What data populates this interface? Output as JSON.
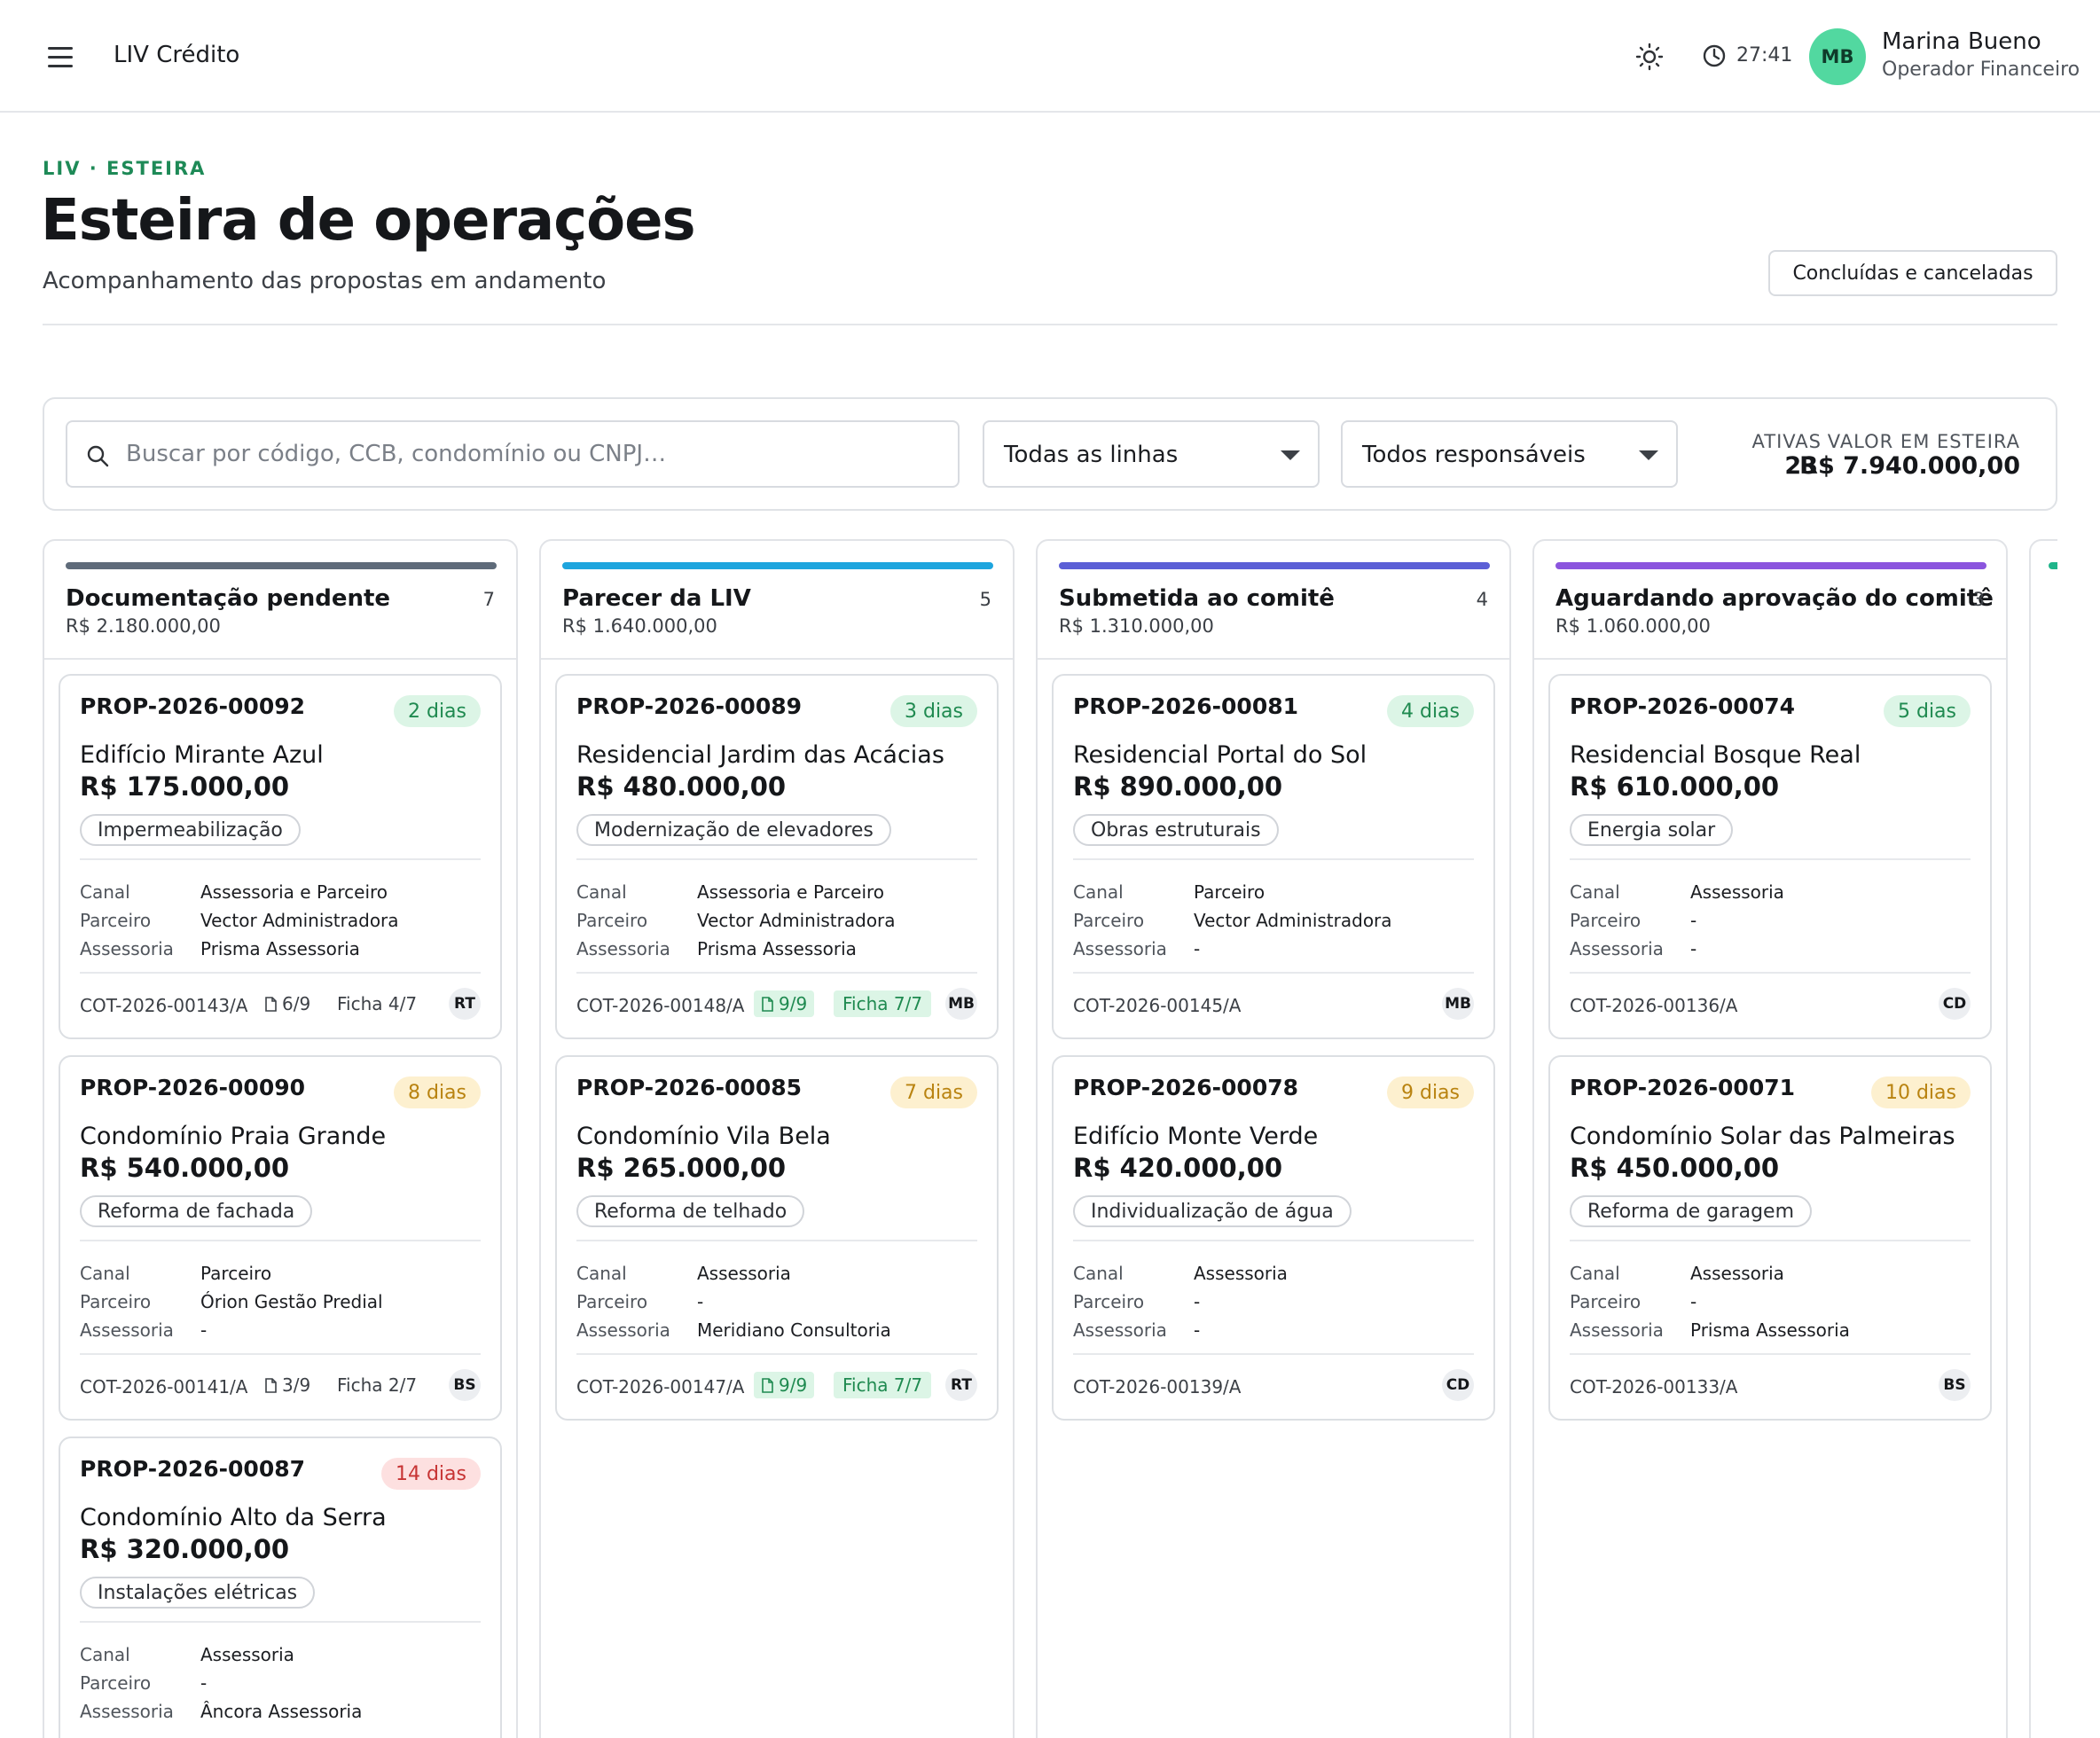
{
  "topbar": {
    "app_title": "LIV Crédito",
    "timer": "27:41",
    "user": {
      "initials": "MB",
      "name": "Marina Bueno",
      "role": "Operador Financeiro",
      "avatar_color": "#52d8a0"
    }
  },
  "header": {
    "breadcrumb": "LIV · ESTEIRA",
    "title": "Esteira de operações",
    "subtitle": "Acompanhamento das propostas em andamento",
    "done_button": "Concluídas e canceladas"
  },
  "filters": {
    "search_placeholder": "Buscar por código, CCB, condomínio ou CNPJ…",
    "search_value": "",
    "lines_select": "Todas as linhas",
    "owners_select": "Todos responsáveis",
    "active_label": "ATIVAS",
    "active_value": "23",
    "pipeline_label": "VALOR EM ESTEIRA",
    "pipeline_value": "R$ 7.940.000,00"
  },
  "labels": {
    "canal": "Canal",
    "parceiro": "Parceiro",
    "assessoria": "Assessoria"
  },
  "columns": [
    {
      "title": "Documentação pendente",
      "count": "7",
      "total": "R$ 2.180.000,00",
      "color": "#5f6b7a",
      "cards": [
        {
          "code": "PROP-2026-00092",
          "days": "2 dias",
          "days_level": "green",
          "name": "Edifício Mirante Azul",
          "value": "R$ 175.000,00",
          "tag": "Impermeabilização",
          "canal": "Assessoria e Parceiro",
          "parceiro": "Vector Administradora",
          "assessoria": "Prisma Assessoria",
          "cot": "COT-2026-00143/A",
          "docs": "6/9",
          "docs_ok": false,
          "ficha": "Ficha 4/7",
          "ficha_ok": false,
          "owner": "RT"
        },
        {
          "code": "PROP-2026-00090",
          "days": "8 dias",
          "days_level": "yellow",
          "name": "Condomínio Praia Grande",
          "value": "R$ 540.000,00",
          "tag": "Reforma de fachada",
          "canal": "Parceiro",
          "parceiro": "Órion Gestão Predial",
          "assessoria": "-",
          "cot": "COT-2026-00141/A",
          "docs": "3/9",
          "docs_ok": false,
          "ficha": "Ficha 2/7",
          "ficha_ok": false,
          "owner": "BS"
        },
        {
          "code": "PROP-2026-00087",
          "days": "14 dias",
          "days_level": "red",
          "name": "Condomínio Alto da Serra",
          "value": "R$ 320.000,00",
          "tag": "Instalações elétricas",
          "canal": "Assessoria",
          "parceiro": "-",
          "assessoria": "Âncora Assessoria",
          "cot": "",
          "docs": "",
          "docs_ok": false,
          "ficha": "",
          "ficha_ok": false,
          "owner": ""
        }
      ]
    },
    {
      "title": "Parecer da LIV",
      "count": "5",
      "total": "R$ 1.640.000,00",
      "color": "#1ea5de",
      "cards": [
        {
          "code": "PROP-2026-00089",
          "days": "3 dias",
          "days_level": "green",
          "name": "Residencial Jardim das Acácias",
          "value": "R$ 480.000,00",
          "tag": "Modernização de elevadores",
          "canal": "Assessoria e Parceiro",
          "parceiro": "Vector Administradora",
          "assessoria": "Prisma Assessoria",
          "cot": "COT-2026-00148/A",
          "docs": "9/9",
          "docs_ok": true,
          "ficha": "Ficha 7/7",
          "ficha_ok": true,
          "owner": "MB"
        },
        {
          "code": "PROP-2026-00085",
          "days": "7 dias",
          "days_level": "yellow",
          "name": "Condomínio Vila Bela",
          "value": "R$ 265.000,00",
          "tag": "Reforma de telhado",
          "canal": "Assessoria",
          "parceiro": "-",
          "assessoria": "Meridiano Consultoria",
          "cot": "COT-2026-00147/A",
          "docs": "9/9",
          "docs_ok": true,
          "ficha": "Ficha 7/7",
          "ficha_ok": true,
          "owner": "RT"
        }
      ]
    },
    {
      "title": "Submetida ao comitê",
      "count": "4",
      "total": "R$ 1.310.000,00",
      "color": "#5b5fd6",
      "cards": [
        {
          "code": "PROP-2026-00081",
          "days": "4 dias",
          "days_level": "green",
          "name": "Residencial Portal do Sol",
          "value": "R$ 890.000,00",
          "tag": "Obras estruturais",
          "canal": "Parceiro",
          "parceiro": "Vector Administradora",
          "assessoria": "-",
          "cot": "COT-2026-00145/A",
          "docs": "",
          "docs_ok": false,
          "ficha": "",
          "ficha_ok": false,
          "owner": "MB"
        },
        {
          "code": "PROP-2026-00078",
          "days": "9 dias",
          "days_level": "yellow",
          "name": "Edifício Monte Verde",
          "value": "R$ 420.000,00",
          "tag": "Individualização de água",
          "canal": "Assessoria",
          "parceiro": "-",
          "assessoria": "-",
          "cot": "COT-2026-00139/A",
          "docs": "",
          "docs_ok": false,
          "ficha": "",
          "ficha_ok": false,
          "owner": "CD"
        }
      ]
    },
    {
      "title": "Aguardando aprovação do comitê",
      "count": "3",
      "total": "R$ 1.060.000,00",
      "color": "#8b55de",
      "cards": [
        {
          "code": "PROP-2026-00074",
          "days": "5 dias",
          "days_level": "green",
          "name": "Residencial Bosque Real",
          "value": "R$ 610.000,00",
          "tag": "Energia solar",
          "canal": "Assessoria",
          "parceiro": "-",
          "assessoria": "-",
          "cot": "COT-2026-00136/A",
          "docs": "",
          "docs_ok": false,
          "ficha": "",
          "ficha_ok": false,
          "owner": "CD"
        },
        {
          "code": "PROP-2026-00071",
          "days": "10 dias",
          "days_level": "yellow",
          "name": "Condomínio Solar das Palmeiras",
          "value": "R$ 450.000,00",
          "tag": "Reforma de garagem",
          "canal": "Assessoria",
          "parceiro": "-",
          "assessoria": "Prisma Assessoria",
          "cot": "COT-2026-00133/A",
          "docs": "",
          "docs_ok": false,
          "ficha": "",
          "ficha_ok": false,
          "owner": "BS"
        }
      ]
    }
  ]
}
